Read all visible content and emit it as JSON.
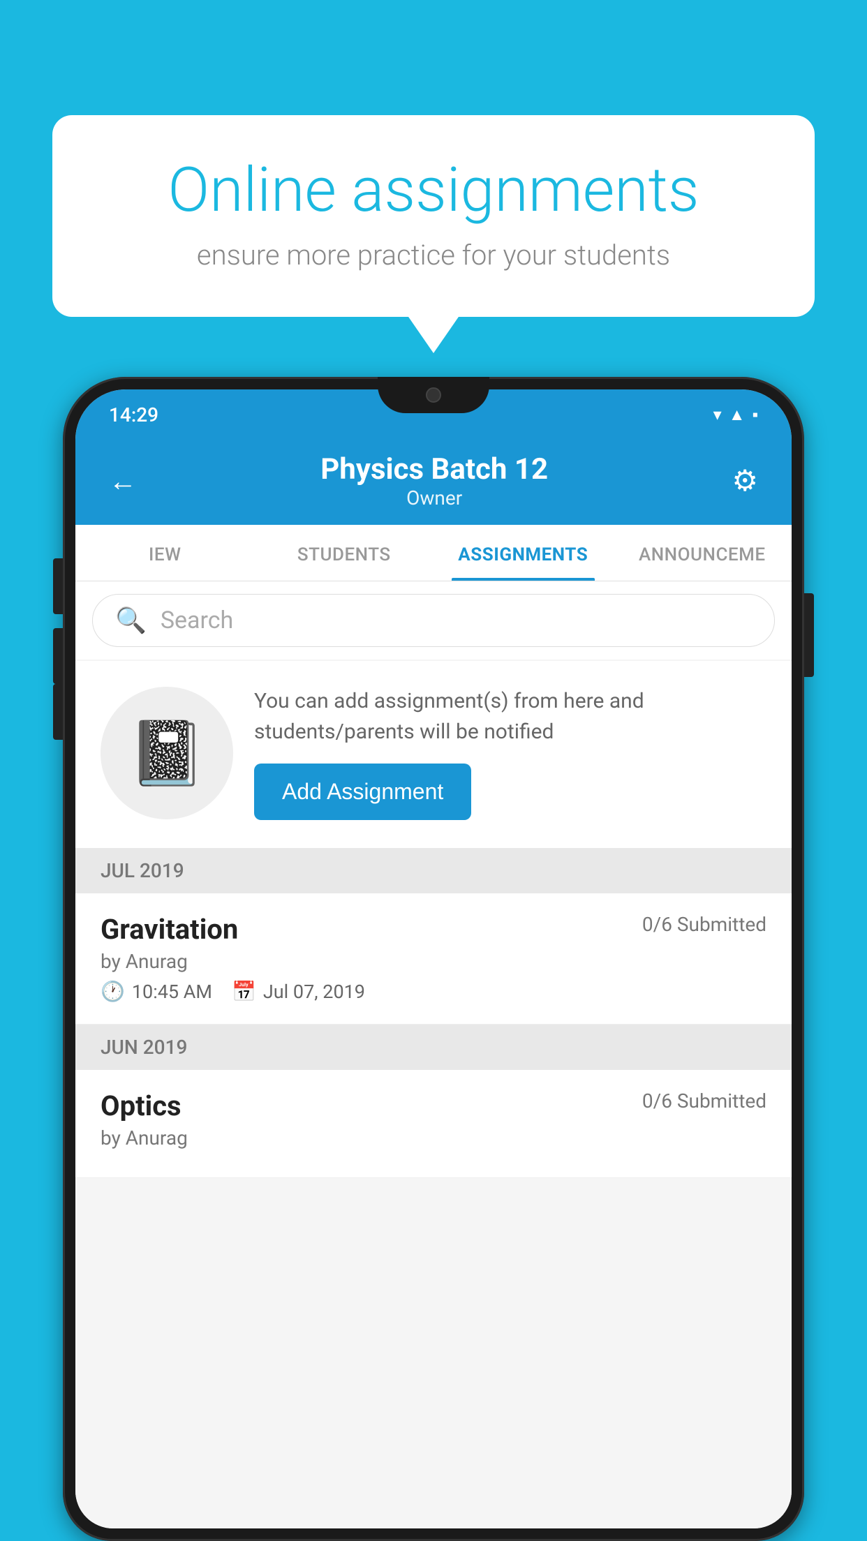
{
  "background_color": "#1BB8E0",
  "speech_bubble": {
    "title": "Online assignments",
    "subtitle": "ensure more practice for your students"
  },
  "status_bar": {
    "time": "14:29",
    "icons": [
      "wifi",
      "signal",
      "battery"
    ]
  },
  "app_header": {
    "title": "Physics Batch 12",
    "subtitle": "Owner",
    "back_label": "←",
    "settings_label": "⚙"
  },
  "tabs": [
    {
      "label": "IEW",
      "active": false
    },
    {
      "label": "STUDENTS",
      "active": false
    },
    {
      "label": "ASSIGNMENTS",
      "active": true
    },
    {
      "label": "ANNOUNCEMENTS",
      "active": false
    }
  ],
  "search": {
    "placeholder": "Search"
  },
  "promo": {
    "description": "You can add assignment(s) from here and students/parents will be notified",
    "button_label": "Add Assignment"
  },
  "sections": [
    {
      "month": "JUL 2019",
      "assignments": [
        {
          "title": "Gravitation",
          "submitted": "0/6 Submitted",
          "by": "by Anurag",
          "time": "10:45 AM",
          "date": "Jul 07, 2019"
        }
      ]
    },
    {
      "month": "JUN 2019",
      "assignments": [
        {
          "title": "Optics",
          "submitted": "0/6 Submitted",
          "by": "by Anurag",
          "time": "",
          "date": ""
        }
      ]
    }
  ]
}
